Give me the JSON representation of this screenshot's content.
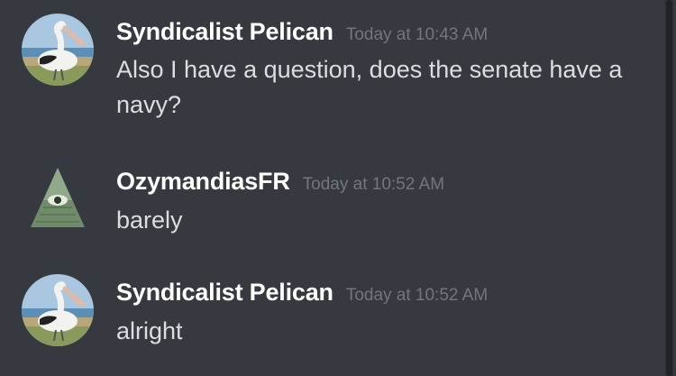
{
  "messages": [
    {
      "author": "Syndicalist Pelican",
      "timestamp": "Today at 10:43 AM",
      "content": "Also I have a question, does the senate have a navy?",
      "avatar_icon": "pelican-avatar"
    },
    {
      "author": "OzymandiasFR",
      "timestamp": "Today at 10:52 AM",
      "content": "barely",
      "avatar_icon": "eye-pyramid-avatar"
    },
    {
      "author": "Syndicalist Pelican",
      "timestamp": "Today at 10:52 AM",
      "content": "alright",
      "avatar_icon": "pelican-avatar"
    }
  ],
  "colors": {
    "background": "#36393f",
    "author": "#ffffff",
    "timestamp": "#72767d",
    "text": "#dcddde"
  }
}
